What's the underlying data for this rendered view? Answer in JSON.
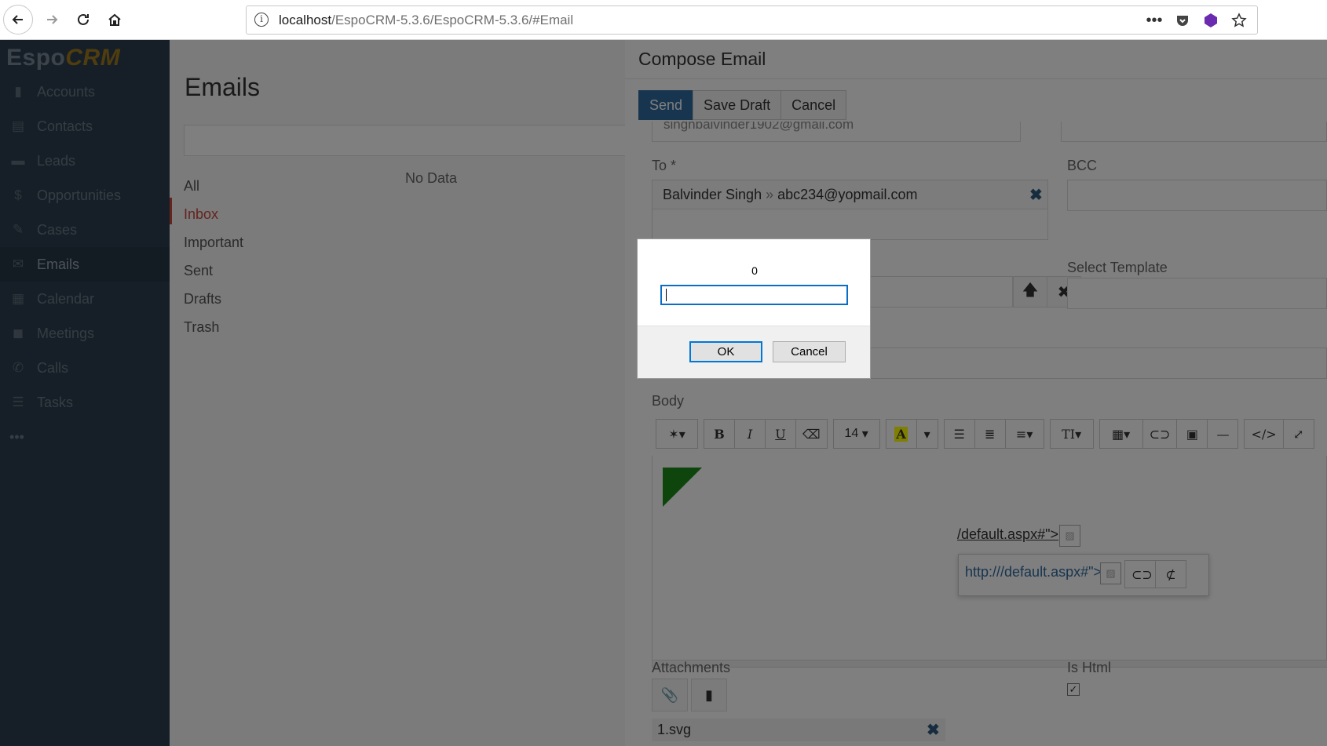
{
  "browser": {
    "url_host": "localhost",
    "url_path": "/EspoCRM-5.3.6/EspoCRM-5.3.6/#Email"
  },
  "sidebar": {
    "logo_espo": "Espo",
    "logo_crm": "CRM",
    "items": [
      {
        "label": "Accounts",
        "icon": "building-icon"
      },
      {
        "label": "Contacts",
        "icon": "contact-card-icon"
      },
      {
        "label": "Leads",
        "icon": "id-card-icon"
      },
      {
        "label": "Opportunities",
        "icon": "dollar-icon"
      },
      {
        "label": "Cases",
        "icon": "wrench-icon"
      },
      {
        "label": "Emails",
        "icon": "envelope-icon"
      },
      {
        "label": "Calendar",
        "icon": "calendar-icon"
      },
      {
        "label": "Meetings",
        "icon": "meeting-icon"
      },
      {
        "label": "Calls",
        "icon": "phone-icon"
      },
      {
        "label": "Tasks",
        "icon": "tasks-icon"
      }
    ],
    "more": "•••"
  },
  "emails": {
    "title": "Emails",
    "folders": [
      "All",
      "Inbox",
      "Important",
      "Sent",
      "Drafts",
      "Trash"
    ],
    "no_data": "No Data"
  },
  "compose": {
    "title": "Compose Email",
    "send": "Send",
    "save_draft": "Save Draft",
    "cancel": "Cancel",
    "from_partial": "singhbalvinder1902@gmail.com",
    "to_label": "To *",
    "to_name": "Balvinder Singh",
    "to_sep": "»",
    "to_email": "abc234@yopmail.com",
    "bcc_label": "BCC",
    "select_template_label": "Select Template",
    "body_label": "Body",
    "font_size": "14",
    "link_text": "/default.aspx#\">",
    "popover_link": "http:///default.aspx#\">",
    "attachments_label": "Attachments",
    "attachment_file": "1.svg",
    "is_html_label": "Is Html"
  },
  "dialog": {
    "message": "0",
    "input_value": "",
    "ok": "OK",
    "cancel": "Cancel"
  },
  "colors": {
    "primary": "#2e6a9e",
    "sidebar_bg": "#2d3f4f",
    "active_folder": "#c9493c",
    "triangle": "#1b8a1b"
  }
}
